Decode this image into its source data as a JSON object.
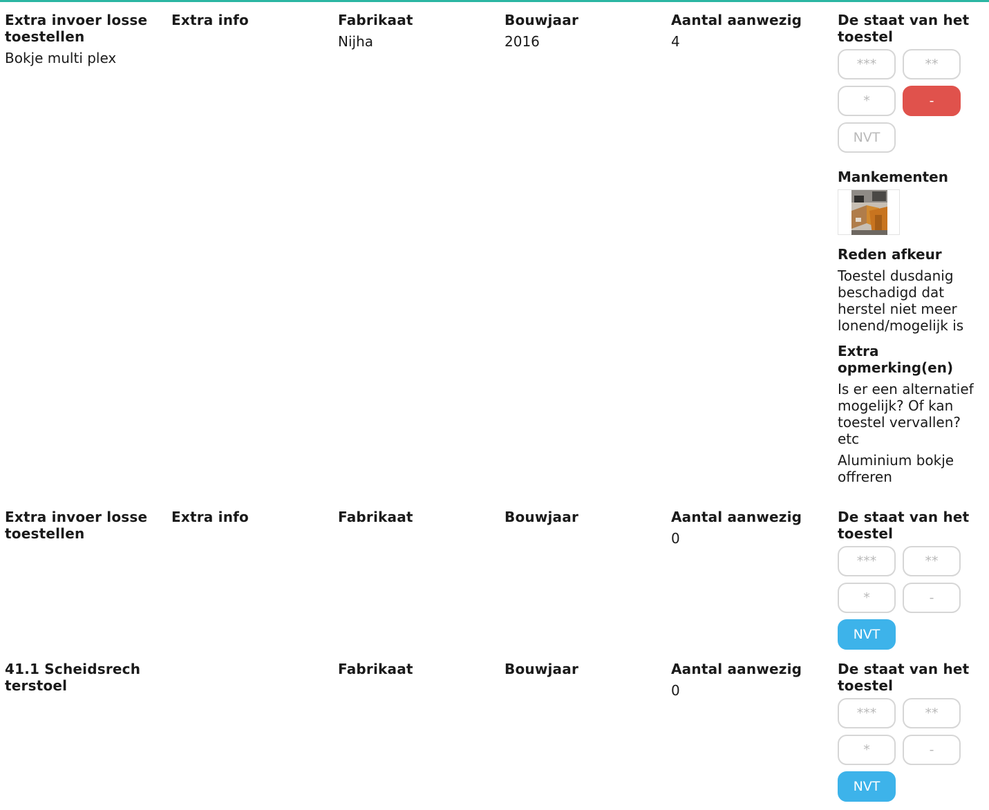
{
  "labels": {
    "extra_invoer": "Extra invoer losse toestellen",
    "extra_info": "Extra info",
    "fabrikaat": "Fabrikaat",
    "bouwjaar": "Bouwjaar",
    "aantal_aanwezig": "Aantal aanwezig",
    "staat": "De staat van het toestel",
    "mankementen": "Mankementen",
    "reden_afkeur": "Reden afkeur",
    "extra_opmerking": "Extra opmerking(en)"
  },
  "rating_options": [
    "***",
    "**",
    "*",
    "-",
    "NVT"
  ],
  "colors": {
    "accent_line": "#2bb6a3",
    "selected_red": "#e0524c",
    "selected_blue": "#3db3ea",
    "button_border": "#d6d6d6",
    "button_text": "#b9b9b9"
  },
  "records": [
    {
      "title": "Extra invoer losse toestellen",
      "name_value": "Bokje multi plex",
      "extra_info_label": "Extra info",
      "fabrikaat_value": "Nijha",
      "bouwjaar_value": "2016",
      "aantal_value": "4",
      "selected_rating": "-",
      "mankementen_photo": "photo-thumbnail",
      "reden_afkeur_value": "Toestel dusdanig beschadigd dat herstel niet meer lonend/mogelijk is",
      "extra_opmerking_hint": "Is er een alternatief mogelijk? Of kan toestel vervallen? etc",
      "extra_opmerking_value": "Aluminium bokje offreren"
    },
    {
      "title": "Extra invoer losse toestellen",
      "extra_info_label": "Extra info",
      "aantal_value": "0",
      "selected_rating": "NVT"
    },
    {
      "title": "41.1 Scheidsrechterstoel",
      "aantal_value": "0",
      "selected_rating": "NVT"
    }
  ]
}
